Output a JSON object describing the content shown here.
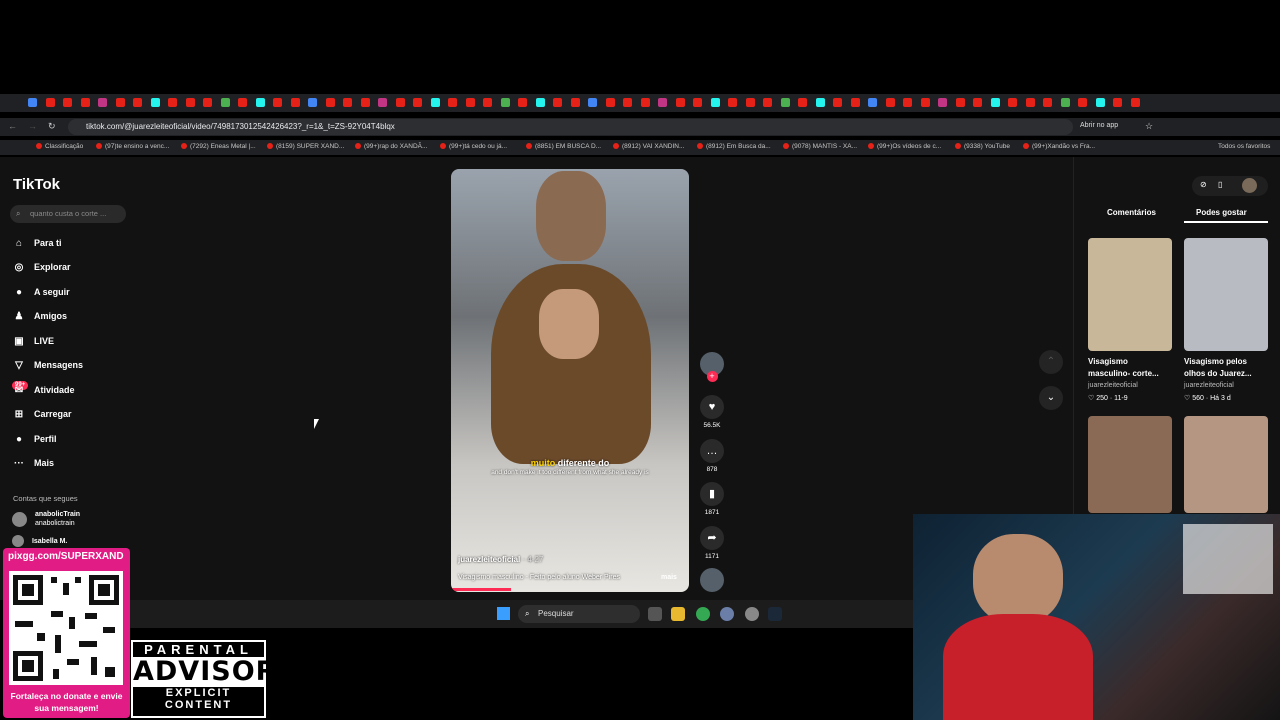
{
  "browser": {
    "url": "tiktok.com/@juarezleiteoficial/video/7498173012542426423?_r=1&_t=ZS-92Y04T4blqx",
    "open_in_app": "Abrir no app",
    "bookmarks": [
      "Classificação",
      "(97)te ensino a venc...",
      "(7292) Eneas Metal |...",
      "(8159) SUPER XAND...",
      "(99+)rap do XANDÃ...",
      "(99+)tá cedo ou já...",
      "(8851) EM BUSCA D...",
      "(8912) VAI XANDIN...",
      "(8912) Em Busca da...",
      "(9078) MANTIS - XA...",
      "(99+)Os vídeos de c...",
      "(9338) YouTube",
      "(99+)Xandão vs Fra..."
    ],
    "all_favorites": "Todos os favoritos"
  },
  "tiktok": {
    "logo": "TikTok",
    "search_placeholder": "quanto custa o corte ...",
    "nav": [
      {
        "icon": "home-icon",
        "glyph": "⌂",
        "label": "Para ti"
      },
      {
        "icon": "compass-icon",
        "glyph": "◎",
        "label": "Explorar"
      },
      {
        "icon": "following-icon",
        "glyph": "●",
        "label": "A seguir"
      },
      {
        "icon": "friends-icon",
        "glyph": "♟",
        "label": "Amigos"
      },
      {
        "icon": "live-icon",
        "glyph": "▣",
        "label": "LIVE"
      },
      {
        "icon": "messages-icon",
        "glyph": "▽",
        "label": "Mensagens"
      },
      {
        "icon": "activity-icon",
        "glyph": "✉",
        "label": "Atividade"
      },
      {
        "icon": "upload-icon",
        "glyph": "⊞",
        "label": "Carregar"
      },
      {
        "icon": "profile-icon",
        "glyph": "●",
        "label": "Perfil"
      },
      {
        "icon": "more-icon",
        "glyph": "···",
        "label": "Mais"
      }
    ],
    "activity_badge": "99+",
    "following_title": "Contas que segues",
    "following": [
      {
        "name": "anabolicTrain",
        "handle": "anabolictrain"
      },
      {
        "name": "Isabella M.",
        "handle": ""
      }
    ],
    "video": {
      "caption_highlight": "muito",
      "caption_main": " diferente do",
      "caption_en": "and don't make it too different from what she already is",
      "author": "juarezleiteoficial",
      "date": " · 4-27",
      "description": "Visagismo masculino - Feito pelo aluno Weber Pires",
      "more": "mais"
    },
    "actions": {
      "likes": "56.5K",
      "comments": "878",
      "saves": "1871",
      "shares": "1171"
    },
    "right_tabs": [
      "Comentários",
      "Podes gostar"
    ],
    "recommended": [
      {
        "title": "Visagismo masculino- corte...",
        "author": "juarezleiteoficial",
        "stats": "♡ 250 · 11-9",
        "color": "#c9b79a"
      },
      {
        "title": "Visagismo pelos olhos do Juarez...",
        "author": "juarezleiteoficial",
        "stats": "♡ 560 · Há 3 d",
        "color": "#b8bcc2"
      },
      {
        "title": "",
        "author": "",
        "stats": "",
        "color": "#8a6a55"
      },
      {
        "title": "",
        "author": "",
        "stats": "",
        "color": "#b59682"
      }
    ]
  },
  "taskbar": {
    "search": "Pesquisar"
  },
  "overlay": {
    "pix_url": "pixgg.com/SUPERXAND",
    "qr_text": "Fortaleça no donate e envie sua mensagem!",
    "advisory_top": "PARENTAL",
    "advisory_mid": "ADVISORY",
    "advisory_bottom": "EXPLICIT CONTENT"
  }
}
